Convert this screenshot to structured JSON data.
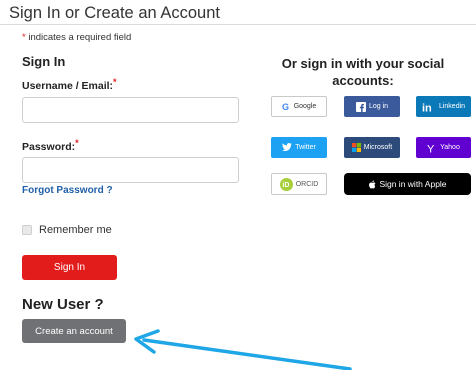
{
  "page_title": "Sign In or Create an Account",
  "required_note": {
    "star": "*",
    "text": " indicates a required field"
  },
  "signin": {
    "heading": "Sign In",
    "username_label": "Username / Email:",
    "username_value": "",
    "password_label": "Password:",
    "password_value": "",
    "required_star": "*",
    "forgot_link": "Forgot Password ?",
    "remember_label": "Remember me",
    "signin_button": "Sign In"
  },
  "new_user": {
    "heading": "New User ?",
    "create_button": "Create an account"
  },
  "social": {
    "heading": "Or sign in with your social accounts:",
    "buttons": {
      "google": "Google",
      "facebook": "Log in",
      "linkedin": "Linkedin",
      "twitter": "Twitter",
      "microsoft": "Microsoft",
      "yahoo": "Yahoo",
      "orcid": "ORCID",
      "apple": "Sign in with Apple"
    }
  },
  "colors": {
    "signin_red": "#e21b1b",
    "create_gray": "#6f7174",
    "link_blue": "#1f5fa8",
    "arrow_blue": "#1ea6e6",
    "facebook": "#3b5a9b",
    "linkedin": "#0b79b8",
    "twitter": "#1da1f2",
    "microsoft": "#2c4a7a",
    "yahoo": "#6001d2"
  },
  "icons": {
    "google": "google-icon",
    "facebook": "facebook-icon",
    "linkedin": "linkedin-icon",
    "twitter": "twitter-icon",
    "microsoft": "microsoft-icon",
    "yahoo": "yahoo-icon",
    "orcid": "orcid-icon",
    "apple": "apple-icon",
    "annotation": "arrow-icon"
  }
}
